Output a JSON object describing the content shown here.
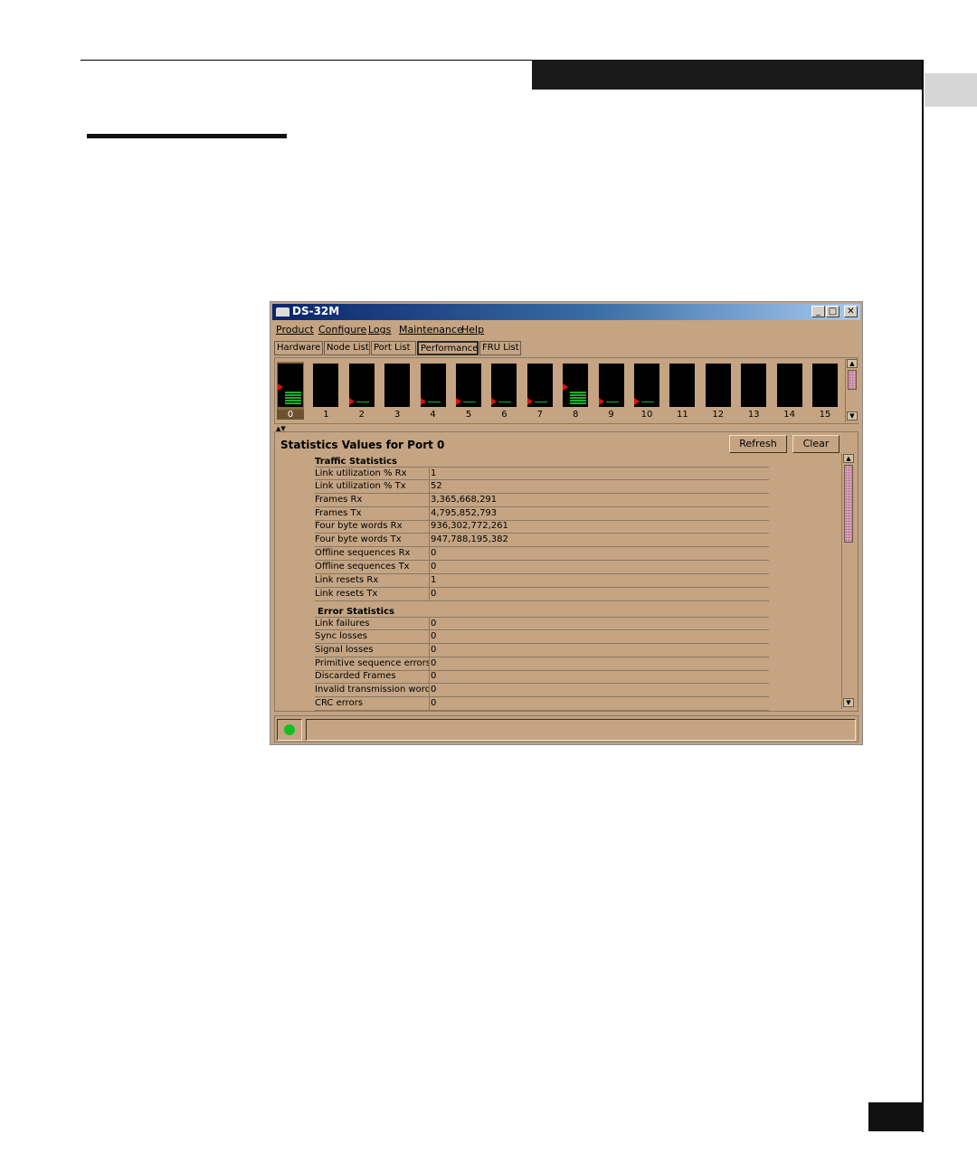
{
  "window": {
    "title": "DS-32M",
    "minimize": "_",
    "maximize": "□",
    "close": "✕"
  },
  "menu": [
    "Product",
    "Configure",
    "Logs",
    "Maintenance",
    "Help"
  ],
  "tabs": [
    "Hardware",
    "Node List",
    "Port List",
    "Performance",
    "FRU List"
  ],
  "active_tab": "Performance",
  "ports": [
    "0",
    "1",
    "2",
    "3",
    "4",
    "5",
    "6",
    "7",
    "8",
    "9",
    "10",
    "11",
    "12",
    "13",
    "14",
    "15"
  ],
  "selected_port": "0",
  "port_activity_levels": [
    0.45,
    0,
    0.05,
    0,
    0.05,
    0.05,
    0.05,
    0.05,
    0.45,
    0.05,
    0.05,
    0,
    0,
    0,
    0,
    0
  ],
  "stats": {
    "title": "Statistics Values for Port 0",
    "refresh_label": "Refresh",
    "clear_label": "Clear",
    "traffic_heading": "Traffic Statistics",
    "traffic": [
      {
        "label": "Link utilization % Rx",
        "value": "1"
      },
      {
        "label": "Link utilization % Tx",
        "value": "52"
      },
      {
        "label": "Frames Rx",
        "value": "3,365,668,291"
      },
      {
        "label": "Frames Tx",
        "value": "4,795,852,793"
      },
      {
        "label": "Four byte words Rx",
        "value": "936,302,772,261"
      },
      {
        "label": "Four byte words Tx",
        "value": "947,788,195,382"
      },
      {
        "label": "Offline sequences Rx",
        "value": "0"
      },
      {
        "label": "Offline sequences Tx",
        "value": "0"
      },
      {
        "label": "Link resets Rx",
        "value": "1"
      },
      {
        "label": "Link resets Tx",
        "value": "0"
      }
    ],
    "error_heading": "Error Statistics",
    "errors": [
      {
        "label": "Link failures",
        "value": "0"
      },
      {
        "label": "Sync losses",
        "value": "0"
      },
      {
        "label": "Signal losses",
        "value": "0"
      },
      {
        "label": "Primitive sequence errors",
        "value": "0"
      },
      {
        "label": "Discarded Frames",
        "value": "0"
      },
      {
        "label": "Invalid transmission words",
        "value": "0"
      },
      {
        "label": "CRC errors",
        "value": "0"
      }
    ]
  },
  "status": {
    "led_color": "#10c020"
  },
  "colors": {
    "panel_bg": "#c4a482",
    "title_blue": "#0a246a",
    "activity_green": "#18b030",
    "indicator_red": "#e01010"
  }
}
